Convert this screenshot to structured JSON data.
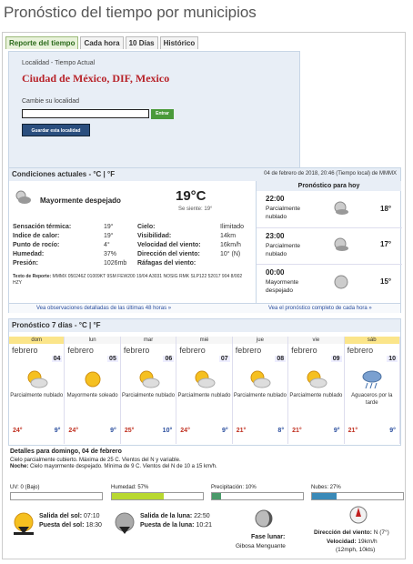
{
  "page_title": "Pronóstico del tiempo por municipios",
  "tabs": [
    "Reporte del tiempo",
    "Cada hora",
    "10 Días",
    "Histórico"
  ],
  "location": {
    "label": "Localidad - Tiempo Actual",
    "city": "Ciudad de México, DIF, Mexico",
    "change_label": "Cambie su localidad",
    "input_value": "",
    "go_label": "Entrar",
    "save_label": "Guardar esta localidad"
  },
  "current": {
    "header_title": "Condiciones actuales - °C | °F",
    "date": "04 de febrero de 2018, 20:46 (Tiempo local) de MMMX",
    "condition": "Mayormente despejado",
    "temp": "19°C",
    "feels": "Se siente: 19°",
    "details_left": [
      {
        "label": "Sensación térmica:",
        "value": "19°"
      },
      {
        "label": "Indice de calor:",
        "value": "19°"
      },
      {
        "label": "Punto de rocío:",
        "value": "4°"
      },
      {
        "label": "Humedad:",
        "value": "37%"
      },
      {
        "label": "Presión:",
        "value": "1026mb"
      }
    ],
    "details_right": [
      {
        "label": "Cielo:",
        "value": "Ilimitado"
      },
      {
        "label": "Visibilidad:",
        "value": "14km"
      },
      {
        "label": "Velocidad del viento:",
        "value": "16km/h"
      },
      {
        "label": "Dirección del viento:",
        "value": "10° (N)"
      },
      {
        "label": "Ráfagas del viento:",
        "value": ""
      }
    ],
    "report_label": "Texto de Reporte:",
    "report_text": "MMMX 050246Z 01009KT 9SM FEW200 19/04 A3031 NOSIG RMK SLP122 52017 904 8/002 HZY",
    "link_obs": "Vea observaciones detalladas de las últimas 48 horas »"
  },
  "today": {
    "title": "Pronóstico para hoy",
    "hours": [
      {
        "time": "22:00",
        "cond": "Parcialmente nublado",
        "temp": "18°"
      },
      {
        "time": "23:00",
        "cond": "Parcialmente nublado",
        "temp": "17°"
      },
      {
        "time": "00:00",
        "cond": "Mayormente despejado",
        "temp": "15°"
      }
    ],
    "link": "Vea el pronóstico completo de cada hora »"
  },
  "week": {
    "title": "Pronóstico 7 días - °C | °F",
    "days": [
      {
        "name": "dom",
        "month": "febrero",
        "num": "04",
        "cond": "Parcialmente nublado",
        "hi": "24°",
        "lo": "9°",
        "icon": "partly-cloudy-icon"
      },
      {
        "name": "lun",
        "month": "febrero",
        "num": "05",
        "cond": "Mayormente soleado",
        "hi": "24°",
        "lo": "9°",
        "icon": "sunny-icon"
      },
      {
        "name": "mar",
        "month": "febrero",
        "num": "06",
        "cond": "Parcialmente nublado",
        "hi": "25°",
        "lo": "10°",
        "icon": "partly-cloudy-icon"
      },
      {
        "name": "mié",
        "month": "febrero",
        "num": "07",
        "cond": "Parcialmente nublado",
        "hi": "24°",
        "lo": "9°",
        "icon": "partly-cloudy-icon"
      },
      {
        "name": "jue",
        "month": "febrero",
        "num": "08",
        "cond": "Parcialmente nublado",
        "hi": "21°",
        "lo": "8°",
        "icon": "partly-cloudy-icon"
      },
      {
        "name": "vie",
        "month": "febrero",
        "num": "09",
        "cond": "Parcialmente nublado",
        "hi": "21°",
        "lo": "9°",
        "icon": "partly-cloudy-icon"
      },
      {
        "name": "sáb",
        "month": "febrero",
        "num": "10",
        "cond": "Aguaceros por la tarde",
        "hi": "21°",
        "lo": "9°",
        "icon": "rain-icon"
      }
    ]
  },
  "details": {
    "title": "Detalles para domingo, 04 de febrero",
    "line1": "Cielo parcialmente cubierto. Máxima de 25 C. Vientos del N y variable.",
    "night_label": "Noche:",
    "line2": "Cielo mayormente despejado. Mínima de 9 C. Vientos del N de 10 a 15 km/h."
  },
  "bars": [
    {
      "label": "UV: 0 (Bajo)",
      "fraction": 0.0,
      "color": "#3a9a3a"
    },
    {
      "label": "Humedad: 57%",
      "fraction": 0.57,
      "color": "#b8d830"
    },
    {
      "label": "Precipitación: 10%",
      "fraction": 0.1,
      "color": "#4a9a6a"
    },
    {
      "label": "Nubes: 27%",
      "fraction": 0.27,
      "color": "#3a8ab8"
    }
  ],
  "astro": {
    "sunrise_label": "Salida del sol:",
    "sunrise": "07:10",
    "sunset_label": "Puesta del sol:",
    "sunset": "18:30",
    "moonrise_label": "Salida de la luna:",
    "moonrise": "22:50",
    "moonset_label": "Puesta de la luna:",
    "moonset": "10:21",
    "moon_phase_label": "Fase lunar:",
    "moon_phase": "Gibosa Menguante",
    "wind_dir_label": "Dirección del viento:",
    "wind_dir": "N (7°)",
    "wind_speed_label": "Velocidad:",
    "wind_speed": "19km/h",
    "wind_speed_alt": "(12mph, 10kts)"
  }
}
